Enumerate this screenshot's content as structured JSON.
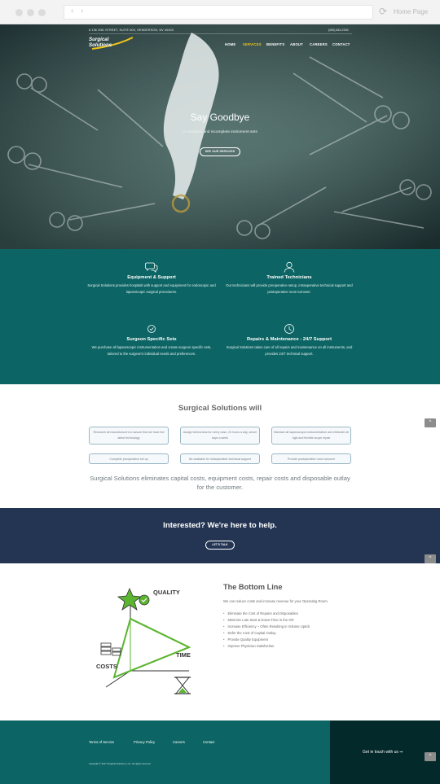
{
  "browser": {
    "tab_title": "Home Page",
    "nav_arrows": "‹ ›",
    "reload_glyph": "⟳"
  },
  "header": {
    "address": "8 136 2ND STREET, SUITE 600, HENDERSON, NV 40400",
    "phone": "(000) 843-2150",
    "logo_line1": "Surgical",
    "logo_line2": "Solutions",
    "nav": [
      "HOME",
      "SERVICES",
      "BENEFITS",
      "ABOUT",
      "CAREERS",
      "CONTACT"
    ],
    "active_nav": "SERVICES"
  },
  "hero": {
    "title": "Say Goodbye",
    "subtitle": "to outdated and incomplete instrument sets",
    "button": "SEE OUR SERVICES"
  },
  "features": [
    {
      "icon": "chat-bubbles-icon",
      "title": "Equipment & Support",
      "text": "Surgical Solutions provides hospitals with support and equipment for endoscopic and laparoscopic surgical procedures."
    },
    {
      "icon": "technician-icon",
      "title": "Trained Technicians",
      "text": "Our technicians will provide preoperative setup, intraoperative technical support and postoperative room turnover."
    },
    {
      "icon": "check-circle-icon",
      "title": "Surgeon Specific Sets",
      "text": "We purchase all laparoscopic instrumentation and create surgeon specific sets, tailored to the surgeon's individual needs and preferences."
    },
    {
      "icon": "clock-icon",
      "title": "Repairs & Maintenance - 24/7 Support",
      "text": "Surgical Solutions takes care of all repairs and maintenance on all instruments, and provides 24/7 technical support."
    }
  ],
  "will": {
    "title": "Surgical Solutions will",
    "boxes": [
      "Research all manufacturers to assure that we have the latest technology",
      "Assign technicians for every case, 24 hours a day, seven days a week",
      "Maintain all laparoscopic instrumentation and eliminate all rigid and flexible scope repair",
      "Complete preoperative set up",
      "Be available for intraoperative technical support",
      "Provide postoperative room turnover"
    ],
    "text": "Surgical Solutions eliminates capital costs, equipment costs, repair costs and disposable outlay for the customer."
  },
  "interested": {
    "title_bold": "Interested?",
    "title_rest": " We're here to help.",
    "button": "LET'S TALK"
  },
  "bottom_line": {
    "title": "The Bottom Line",
    "intro": "We can reduce costs and increase revenue for your Operating Room.",
    "items": [
      "Eliminate the Cost of Repairs and Disposables",
      "Minimize Late Start & Down-Time in the OR",
      "Increase Efficiency – Often Resulting in Volume Uptick",
      "Defer the Cost of Capital Outlay",
      "Provide Quality Equipment",
      "Improve Physician Satisfaction"
    ],
    "diagram_labels": {
      "quality": "QUALITY",
      "time": "TIME",
      "costs": "COSTS"
    }
  },
  "footer": {
    "links": [
      "Terms of Service",
      "Privacy Policy",
      "Careers",
      "Contact"
    ],
    "copyright": "Copyright © 2017 Surgical Solutions, LLC. All rights reserved.",
    "cta": "Get in touch with us ➞"
  },
  "scroll_top_glyph": "^",
  "colors": {
    "teal": "#0d6464",
    "navy": "#243553",
    "dark_teal": "#04292a",
    "accent_yellow": "#f0c419",
    "green": "#5cb531"
  }
}
